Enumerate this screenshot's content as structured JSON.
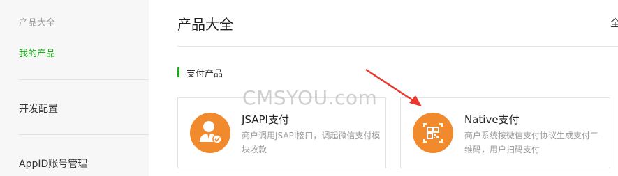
{
  "sidebar": {
    "category": "产品大全",
    "active_item": "我的产品",
    "dev_config": "开发配置",
    "appid_mgmt": "AppID账号管理"
  },
  "header": {
    "title": "产品大全",
    "right_text": "全"
  },
  "section": {
    "title": "支付产品"
  },
  "watermark": "CMSYOU.com",
  "cards": [
    {
      "title": "JSAPI支付",
      "desc": "商户调用JSAPI接口，调起微信支付模块收款",
      "icon": "user-check-icon"
    },
    {
      "title": "Native支付",
      "desc": "商户系统按微信支付协议生成支付二维码，用户扫码支付",
      "icon": "qr-code-icon"
    }
  ],
  "colors": {
    "accent": "#1aad19",
    "icon_bg": "#f08a2d",
    "arrow": "#e8382f"
  }
}
